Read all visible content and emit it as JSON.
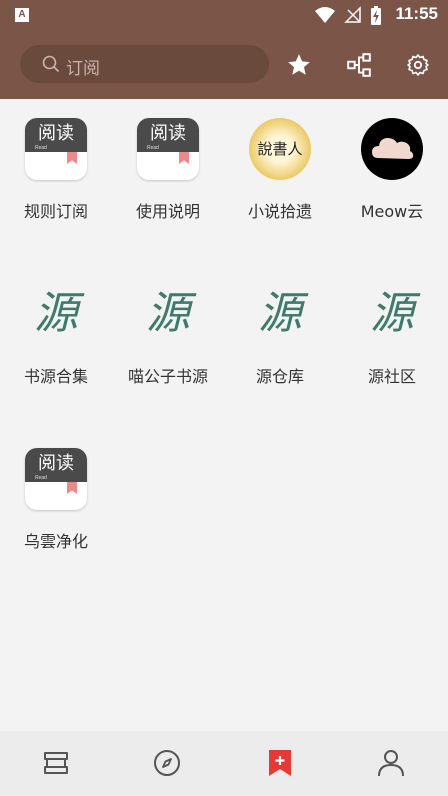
{
  "status_bar": {
    "time": "11:55",
    "app_badge": "A"
  },
  "toolbar": {
    "search_placeholder": "订阅"
  },
  "colors": {
    "toolbar": "#7a5548",
    "accent": "#e53935",
    "background": "#f3f3f3"
  },
  "subscriptions": [
    {
      "label": "规则订阅",
      "logo": "read-app-logo"
    },
    {
      "label": "使用说明",
      "logo": "read-app-logo"
    },
    {
      "label": "小说拾遗",
      "logo": "novel-logo"
    },
    {
      "label": "Meow云",
      "logo": "cloud-logo"
    },
    {
      "label": "书源合集",
      "logo": "yuan-logo"
    },
    {
      "label": "喵公子书源",
      "logo": "yuan-logo"
    },
    {
      "label": "源仓库",
      "logo": "yuan-logo"
    },
    {
      "label": "源社区",
      "logo": "yuan-logo"
    },
    {
      "label": "乌雲净化",
      "logo": "read-app-logo"
    }
  ],
  "logo_text": {
    "read_title": "阅读",
    "read_sub": "Read",
    "yuan": "源",
    "novel": "說書人"
  },
  "bottom_nav": [
    "bookshelf-icon",
    "compass-icon",
    "bookmark-add-icon",
    "person-icon"
  ],
  "bottom_nav_selected": 2
}
